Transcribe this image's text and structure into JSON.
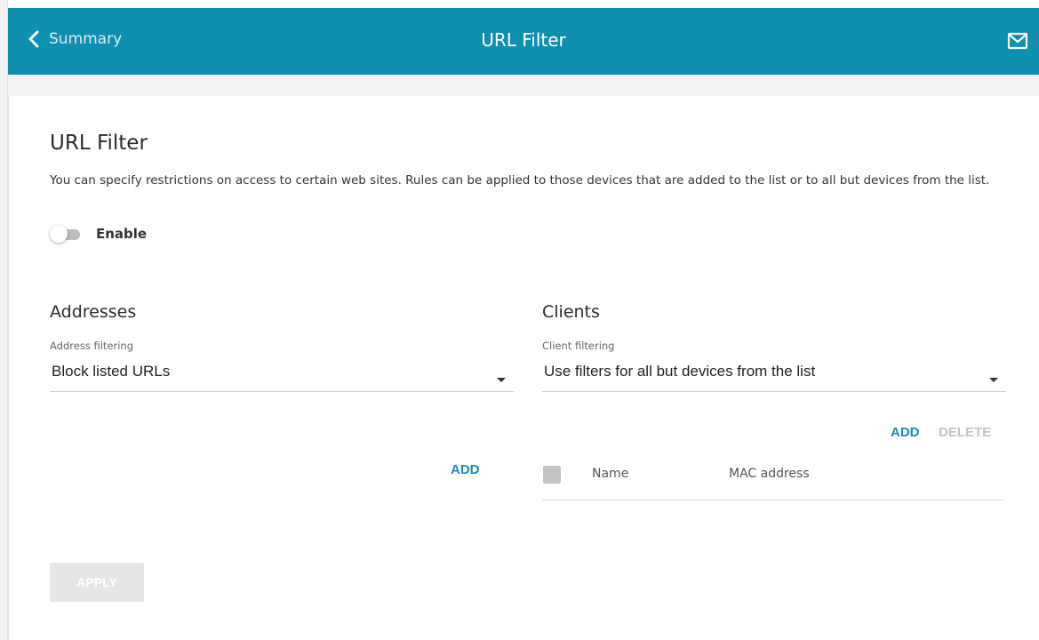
{
  "header": {
    "back_label": "Summary",
    "title": "URL Filter",
    "back_icon": "chevron-left-icon",
    "mail_icon": "mail-icon",
    "bar_color": "#0f8fb0"
  },
  "main": {
    "title": "URL Filter",
    "description": "You can specify restrictions on access to certain web sites. Rules can be applied to those devices that are added to the list or to all but devices from the list.",
    "enable_label": "Enable",
    "enable_state": false
  },
  "addresses": {
    "title": "Addresses",
    "filter_label": "Address filtering",
    "filter_value": "Block listed URLs",
    "add_label": "ADD"
  },
  "clients": {
    "title": "Clients",
    "filter_label": "Client filtering",
    "filter_value": "Use filters for all but devices from the list",
    "add_label": "ADD",
    "delete_label": "DELETE",
    "columns": [
      "Name",
      "MAC address"
    ]
  },
  "apply_label": "APPLY",
  "colors": {
    "accent": "#1a8cb0",
    "disabled": "#c2c2c2"
  }
}
